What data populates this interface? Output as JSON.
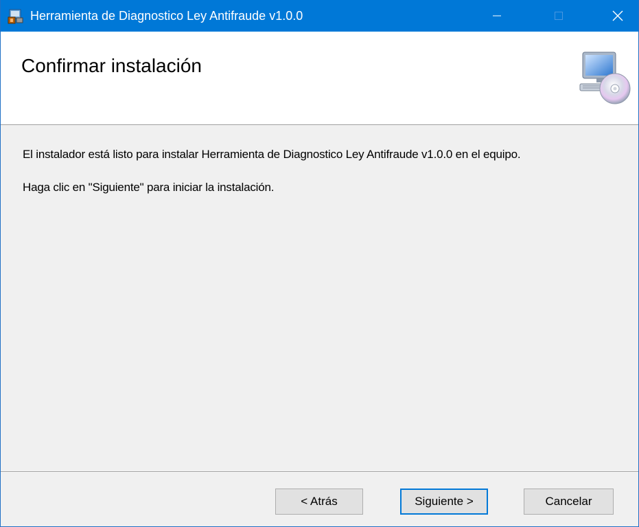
{
  "window": {
    "title": "Herramienta de Diagnostico Ley Antifraude v1.0.0",
    "accent_color": "#0078d7",
    "caption_buttons": {
      "minimize_icon": "minimize-icon",
      "maximize_icon": "maximize-icon",
      "close_icon": "close-icon"
    }
  },
  "banner": {
    "title": "Confirmar instalación",
    "icon": "computer-cd-icon"
  },
  "content": {
    "line1": "El instalador está listo para instalar Herramienta de Diagnostico Ley Antifraude v1.0.0 en el equipo.",
    "line2": "Haga clic en \"Siguiente\" para iniciar la instalación."
  },
  "buttons": {
    "back_label": "< Atrás",
    "next_label": "Siguiente >",
    "cancel_label": "Cancelar"
  }
}
